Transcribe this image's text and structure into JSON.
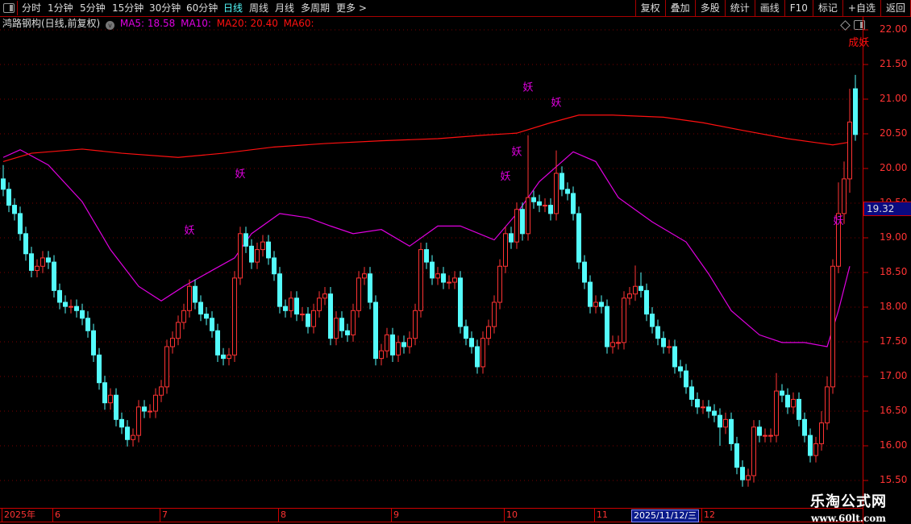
{
  "toolbar": {
    "periods": [
      "分时",
      "1分钟",
      "5分钟",
      "15分钟",
      "30分钟",
      "60分钟",
      "日线",
      "周线",
      "月线",
      "多周期",
      "更多 >"
    ],
    "active_period": "日线",
    "right_buttons": [
      "复权",
      "叠加",
      "多股",
      "统计",
      "画线",
      "F10",
      "标记",
      "+自选",
      "返回"
    ]
  },
  "info": {
    "title": "鸿路钢构(日线,前复权)",
    "ma5": "MA5: 18.58",
    "ma10": "MA10:",
    "ma20": "MA20: 20.40",
    "ma60": "MA60:"
  },
  "colors": {
    "up": "#ff3333",
    "down": "#54fcfc",
    "ma_magenta": "#e000e0",
    "ma_red": "#ff1010",
    "grid": "#7a0000",
    "axis": "#cc0000"
  },
  "current_price": "19.32",
  "watermark": {
    "line1": "乐淘公式网",
    "line2": "www.60lt.com"
  },
  "chart_data": {
    "type": "candlestick",
    "ylim": [
      15.4,
      22.1
    ],
    "yticks": [
      "22.00",
      "21.50",
      "21.00",
      "20.50",
      "20.00",
      "19.50",
      "19.00",
      "18.50",
      "18.00",
      "17.50",
      "17.00",
      "16.50",
      "16.00",
      "15.50"
    ],
    "grid": true,
    "x_labels": [
      {
        "bar": 0,
        "text": "2025年"
      },
      {
        "bar": 9,
        "text": "6"
      },
      {
        "bar": 28,
        "text": "7"
      },
      {
        "bar": 49,
        "text": "8"
      },
      {
        "bar": 69,
        "text": "9"
      },
      {
        "bar": 89,
        "text": "10"
      },
      {
        "bar": 105,
        "text": "11"
      },
      {
        "bar": 124,
        "text": "12"
      }
    ],
    "selected_date": {
      "bar": 111,
      "text": "2025/11/12/三"
    },
    "candles": [
      [
        19.85,
        20.05,
        19.6,
        19.7
      ],
      [
        19.7,
        19.8,
        19.37,
        19.47
      ],
      [
        19.47,
        19.57,
        19.25,
        19.35
      ],
      [
        19.35,
        19.45,
        18.96,
        19.06
      ],
      [
        19.06,
        19.16,
        18.67,
        18.77
      ],
      [
        18.77,
        18.87,
        18.43,
        18.53
      ],
      [
        18.53,
        18.69,
        18.43,
        18.59
      ],
      [
        18.59,
        18.81,
        18.49,
        18.71
      ],
      [
        18.71,
        18.81,
        18.55,
        18.65
      ],
      [
        18.65,
        18.75,
        18.14,
        18.24
      ],
      [
        18.24,
        18.34,
        17.97,
        18.07
      ],
      [
        18.07,
        18.17,
        17.91,
        18.01
      ],
      [
        18.01,
        18.11,
        17.91,
        18.01
      ],
      [
        18.01,
        18.11,
        17.85,
        17.95
      ],
      [
        17.95,
        18.05,
        17.74,
        17.84
      ],
      [
        17.84,
        17.94,
        17.56,
        17.66
      ],
      [
        17.66,
        17.76,
        17.21,
        17.31
      ],
      [
        17.31,
        17.41,
        16.81,
        16.91
      ],
      [
        16.91,
        17.01,
        16.52,
        16.62
      ],
      [
        16.62,
        16.83,
        16.52,
        16.73
      ],
      [
        16.73,
        16.83,
        16.28,
        16.38
      ],
      [
        16.38,
        16.48,
        16.17,
        16.27
      ],
      [
        16.27,
        16.37,
        15.99,
        16.09
      ],
      [
        16.09,
        16.25,
        15.99,
        16.15
      ],
      [
        16.15,
        16.66,
        16.05,
        16.56
      ],
      [
        16.56,
        16.66,
        16.4,
        16.5
      ],
      [
        16.5,
        16.6,
        16.4,
        16.5
      ],
      [
        16.5,
        16.83,
        16.4,
        16.73
      ],
      [
        16.73,
        16.95,
        16.63,
        16.85
      ],
      [
        16.85,
        17.53,
        16.75,
        17.43
      ],
      [
        17.43,
        17.65,
        17.33,
        17.55
      ],
      [
        17.55,
        17.88,
        17.45,
        17.78
      ],
      [
        17.78,
        18.05,
        17.68,
        17.95
      ],
      [
        17.95,
        18.4,
        17.85,
        18.3
      ],
      [
        18.3,
        18.4,
        17.97,
        18.07
      ],
      [
        18.07,
        18.17,
        17.8,
        17.9
      ],
      [
        17.9,
        18.0,
        17.74,
        17.84
      ],
      [
        17.84,
        17.94,
        17.56,
        17.66
      ],
      [
        17.66,
        17.76,
        17.21,
        17.31
      ],
      [
        17.31,
        17.41,
        17.16,
        17.26
      ],
      [
        17.26,
        17.41,
        17.16,
        17.31
      ],
      [
        17.31,
        18.52,
        17.21,
        18.42
      ],
      [
        18.42,
        19.16,
        18.32,
        19.06
      ],
      [
        19.06,
        19.16,
        18.78,
        18.88
      ],
      [
        18.88,
        18.98,
        18.55,
        18.65
      ],
      [
        18.65,
        18.93,
        18.55,
        18.83
      ],
      [
        18.83,
        19.04,
        18.73,
        18.94
      ],
      [
        18.94,
        19.04,
        18.61,
        18.71
      ],
      [
        18.71,
        18.81,
        18.38,
        18.48
      ],
      [
        18.48,
        18.58,
        17.91,
        18.01
      ],
      [
        18.01,
        18.11,
        17.85,
        17.95
      ],
      [
        17.95,
        18.23,
        17.85,
        18.13
      ],
      [
        18.13,
        18.23,
        17.8,
        17.9
      ],
      [
        17.9,
        18.0,
        17.8,
        17.9
      ],
      [
        17.9,
        18.0,
        17.62,
        17.72
      ],
      [
        17.72,
        18.05,
        17.62,
        17.95
      ],
      [
        17.95,
        18.23,
        17.85,
        18.13
      ],
      [
        18.13,
        18.29,
        18.03,
        18.19
      ],
      [
        18.19,
        18.29,
        17.45,
        17.55
      ],
      [
        17.55,
        17.94,
        17.45,
        17.84
      ],
      [
        17.84,
        17.94,
        17.56,
        17.66
      ],
      [
        17.66,
        17.76,
        17.5,
        17.6
      ],
      [
        17.6,
        18.05,
        17.5,
        17.95
      ],
      [
        17.95,
        18.52,
        17.85,
        18.42
      ],
      [
        18.42,
        18.58,
        18.32,
        18.48
      ],
      [
        18.48,
        18.58,
        17.97,
        18.07
      ],
      [
        18.07,
        18.17,
        17.16,
        17.26
      ],
      [
        17.26,
        17.47,
        17.16,
        17.37
      ],
      [
        17.37,
        17.7,
        17.27,
        17.6
      ],
      [
        17.6,
        17.7,
        17.21,
        17.31
      ],
      [
        17.31,
        17.59,
        17.21,
        17.49
      ],
      [
        17.49,
        17.59,
        17.33,
        17.43
      ],
      [
        17.43,
        17.65,
        17.33,
        17.55
      ],
      [
        17.55,
        18.05,
        17.45,
        17.95
      ],
      [
        17.95,
        18.93,
        17.85,
        18.83
      ],
      [
        18.83,
        18.93,
        18.55,
        18.65
      ],
      [
        18.65,
        18.75,
        18.32,
        18.42
      ],
      [
        18.42,
        18.58,
        18.32,
        18.48
      ],
      [
        18.48,
        18.58,
        18.26,
        18.36
      ],
      [
        18.36,
        18.46,
        18.26,
        18.36
      ],
      [
        18.36,
        18.52,
        18.26,
        18.42
      ],
      [
        18.42,
        18.52,
        17.62,
        17.72
      ],
      [
        17.72,
        17.82,
        17.45,
        17.55
      ],
      [
        17.55,
        17.65,
        17.33,
        17.43
      ],
      [
        17.43,
        17.53,
        17.04,
        17.14
      ],
      [
        17.14,
        17.65,
        17.04,
        17.55
      ],
      [
        17.55,
        17.82,
        17.45,
        17.72
      ],
      [
        17.72,
        18.17,
        17.62,
        18.07
      ],
      [
        18.07,
        18.69,
        17.97,
        18.59
      ],
      [
        18.59,
        19.16,
        18.49,
        19.06
      ],
      [
        19.06,
        19.16,
        18.84,
        18.94
      ],
      [
        18.94,
        19.51,
        18.84,
        19.41
      ],
      [
        19.41,
        19.51,
        18.96,
        19.06
      ],
      [
        19.06,
        20.48,
        18.96,
        19.58
      ],
      [
        19.58,
        19.68,
        19.42,
        19.52
      ],
      [
        19.52,
        19.62,
        19.37,
        19.47
      ],
      [
        19.47,
        19.57,
        19.37,
        19.47
      ],
      [
        19.47,
        19.57,
        19.25,
        19.35
      ],
      [
        19.35,
        20.26,
        19.25,
        19.93
      ],
      [
        19.93,
        20.03,
        19.6,
        19.7
      ],
      [
        19.7,
        19.8,
        19.54,
        19.64
      ],
      [
        19.64,
        19.74,
        19.25,
        19.35
      ],
      [
        19.35,
        19.45,
        18.55,
        18.65
      ],
      [
        18.65,
        18.75,
        18.26,
        18.36
      ],
      [
        18.36,
        18.46,
        17.91,
        18.01
      ],
      [
        18.01,
        18.17,
        17.91,
        18.07
      ],
      [
        18.07,
        18.17,
        17.91,
        18.01
      ],
      [
        18.01,
        18.11,
        17.33,
        17.43
      ],
      [
        17.43,
        17.59,
        17.33,
        17.49
      ],
      [
        17.49,
        17.59,
        17.39,
        17.49
      ],
      [
        17.49,
        18.23,
        17.39,
        18.13
      ],
      [
        18.13,
        18.29,
        18.03,
        18.19
      ],
      [
        18.19,
        18.6,
        18.09,
        18.3
      ],
      [
        18.3,
        18.5,
        18.14,
        18.24
      ],
      [
        18.24,
        18.34,
        17.8,
        17.9
      ],
      [
        17.9,
        18.0,
        17.62,
        17.72
      ],
      [
        17.72,
        17.82,
        17.45,
        17.55
      ],
      [
        17.55,
        17.65,
        17.33,
        17.43
      ],
      [
        17.43,
        17.53,
        17.33,
        17.43
      ],
      [
        17.43,
        17.53,
        17.04,
        17.14
      ],
      [
        17.14,
        17.24,
        16.98,
        17.08
      ],
      [
        17.08,
        17.18,
        16.75,
        16.85
      ],
      [
        16.85,
        16.95,
        16.57,
        16.67
      ],
      [
        16.67,
        16.77,
        16.46,
        16.56
      ],
      [
        16.56,
        16.66,
        16.46,
        16.56
      ],
      [
        16.56,
        16.66,
        16.4,
        16.5
      ],
      [
        16.5,
        16.6,
        16.34,
        16.44
      ],
      [
        16.44,
        16.54,
        16.0,
        16.27
      ],
      [
        16.27,
        16.48,
        16.17,
        16.38
      ],
      [
        16.38,
        16.48,
        15.93,
        16.03
      ],
      [
        16.03,
        16.13,
        15.59,
        15.69
      ],
      [
        15.69,
        15.79,
        15.41,
        15.51
      ],
      [
        15.51,
        15.67,
        15.41,
        15.57
      ],
      [
        15.57,
        16.37,
        15.47,
        16.27
      ],
      [
        16.27,
        16.37,
        16.05,
        16.15
      ],
      [
        16.15,
        16.25,
        16.05,
        16.15
      ],
      [
        16.15,
        16.25,
        16.05,
        16.15
      ],
      [
        16.15,
        17.05,
        16.05,
        16.79
      ],
      [
        16.79,
        16.89,
        16.63,
        16.73
      ],
      [
        16.73,
        16.83,
        16.46,
        16.56
      ],
      [
        16.56,
        16.77,
        16.46,
        16.67
      ],
      [
        16.67,
        16.77,
        16.28,
        16.38
      ],
      [
        16.38,
        16.48,
        16.05,
        16.15
      ],
      [
        16.15,
        16.25,
        15.76,
        15.86
      ],
      [
        15.86,
        16.13,
        15.76,
        16.03
      ],
      [
        16.03,
        16.5,
        15.93,
        16.33
      ],
      [
        16.33,
        17.0,
        16.23,
        16.85
      ],
      [
        16.85,
        18.69,
        16.75,
        18.59
      ],
      [
        18.59,
        19.8,
        18.49,
        19.35
      ],
      [
        19.35,
        20.1,
        19.2,
        19.85
      ],
      [
        19.85,
        21.15,
        19.65,
        20.67
      ],
      [
        21.15,
        21.35,
        20.4,
        20.49
      ]
    ],
    "lines": [
      {
        "name": "MA5",
        "color": "#e000e0",
        "points": [
          [
            0,
            20.16
          ],
          [
            3,
            20.27
          ],
          [
            8,
            20.05
          ],
          [
            14,
            19.52
          ],
          [
            19,
            18.83
          ],
          [
            24,
            18.3
          ],
          [
            28,
            18.09
          ],
          [
            32,
            18.3
          ],
          [
            37,
            18.53
          ],
          [
            41,
            18.71
          ],
          [
            44,
            19.06
          ],
          [
            49,
            19.35
          ],
          [
            54,
            19.29
          ],
          [
            58,
            19.17
          ],
          [
            62,
            19.06
          ],
          [
            67,
            19.12
          ],
          [
            72,
            18.88
          ],
          [
            77,
            19.17
          ],
          [
            81,
            19.17
          ],
          [
            87,
            18.97
          ],
          [
            91,
            19.35
          ],
          [
            95,
            19.81
          ],
          [
            101,
            20.24
          ],
          [
            105,
            20.1
          ],
          [
            109,
            19.58
          ],
          [
            115,
            19.23
          ],
          [
            121,
            18.94
          ],
          [
            125,
            18.48
          ],
          [
            129,
            17.95
          ],
          [
            134,
            17.6
          ],
          [
            138,
            17.49
          ],
          [
            142,
            17.49
          ],
          [
            146,
            17.43
          ],
          [
            148,
            17.95
          ],
          [
            150,
            18.59
          ]
        ]
      },
      {
        "name": "MA20",
        "color": "#ff1010",
        "points": [
          [
            0,
            20.1
          ],
          [
            5,
            20.22
          ],
          [
            14,
            20.28
          ],
          [
            21,
            20.22
          ],
          [
            31,
            20.16
          ],
          [
            39,
            20.22
          ],
          [
            48,
            20.31
          ],
          [
            57,
            20.36
          ],
          [
            67,
            20.4
          ],
          [
            77,
            20.43
          ],
          [
            85,
            20.48
          ],
          [
            91,
            20.51
          ],
          [
            97,
            20.66
          ],
          [
            102,
            20.77
          ],
          [
            108,
            20.77
          ],
          [
            117,
            20.74
          ],
          [
            124,
            20.66
          ],
          [
            131,
            20.55
          ],
          [
            139,
            20.43
          ],
          [
            147,
            20.34
          ],
          [
            150,
            20.38
          ]
        ]
      }
    ],
    "annotations": [
      {
        "bar": 33,
        "price": 19.06,
        "text": "妖",
        "color": "#e000e0"
      },
      {
        "bar": 42,
        "price": 19.87,
        "text": "妖",
        "color": "#e000e0"
      },
      {
        "bar": 89,
        "price": 19.84,
        "text": "妖",
        "color": "#e000e0"
      },
      {
        "bar": 91,
        "price": 20.19,
        "text": "妖",
        "color": "#e000e0"
      },
      {
        "bar": 93,
        "price": 21.12,
        "text": "妖",
        "color": "#e000e0"
      },
      {
        "bar": 98,
        "price": 20.9,
        "text": "妖",
        "color": "#e000e0"
      },
      {
        "bar": 148,
        "price": 19.2,
        "text": "妖",
        "color": "#e000e0"
      },
      {
        "bar": 151.6,
        "price": 21.77,
        "text": "成妖",
        "color": "#ff1010"
      }
    ]
  }
}
